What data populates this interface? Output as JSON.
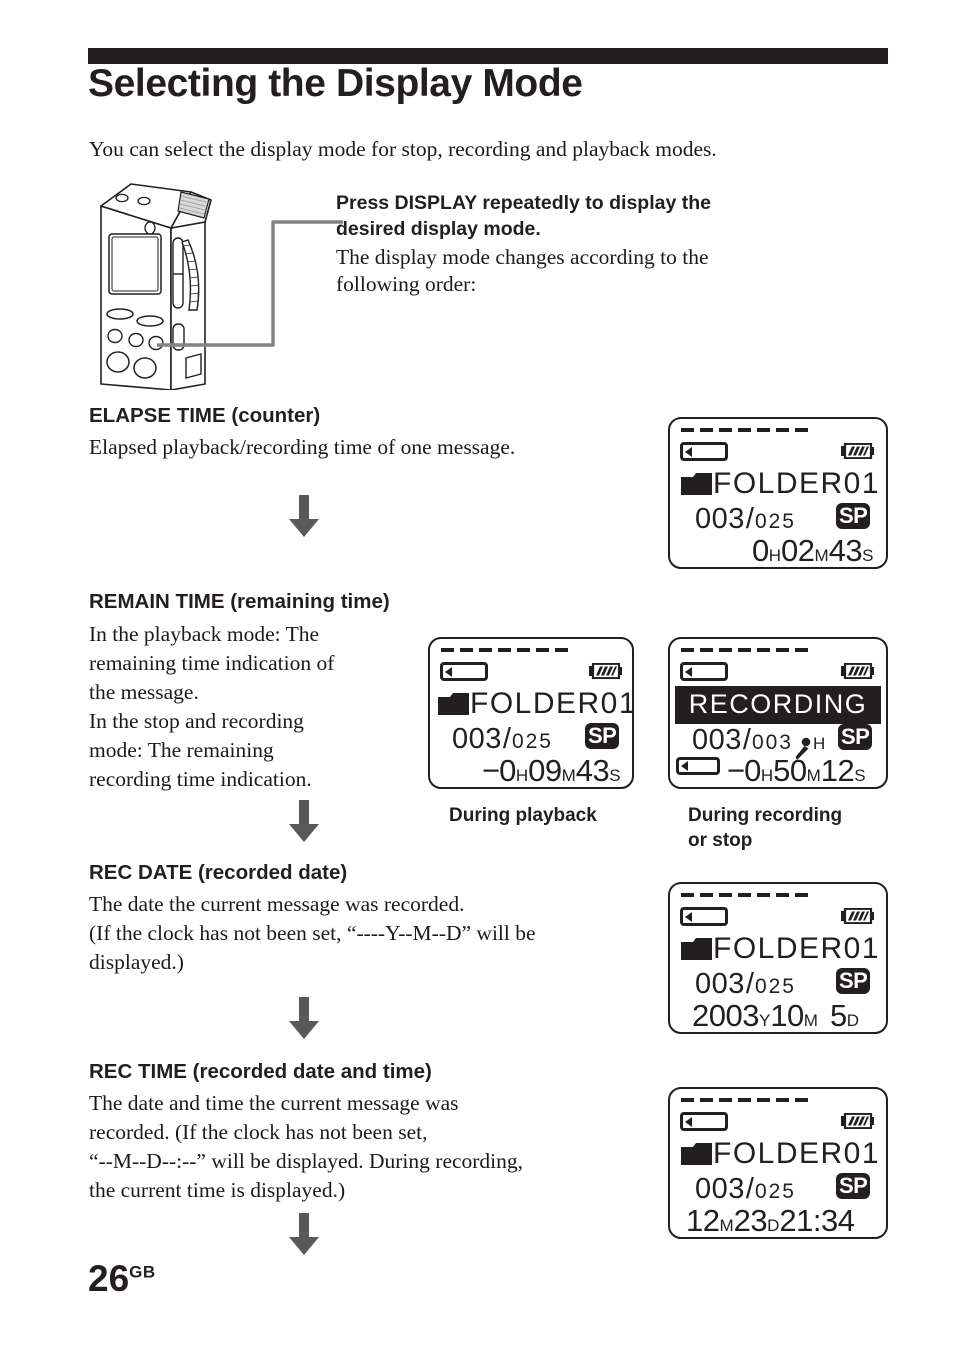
{
  "page": {
    "title": "Selecting the Display Mode",
    "intro": "You can select the display mode for stop, recording and playback modes.",
    "page_number": "26",
    "page_number_suffix": "GB"
  },
  "callout": {
    "bold_line_1": "Press DISPLAY repeatedly to display the",
    "bold_line_2": "desired display mode.",
    "normal_line_1": "The display mode changes according to the",
    "normal_line_2": "following order:"
  },
  "sections": [
    {
      "heading": "ELAPSE TIME (counter)",
      "body": "Elapsed playback/recording time of one message."
    },
    {
      "heading": "REMAIN TIME (remaining time)",
      "body_lines": [
        "In the playback mode: The",
        "remaining time indication of",
        "the message.",
        "In the stop and recording",
        "mode: The remaining",
        "recording time indication."
      ]
    },
    {
      "heading": "REC DATE (recorded date)",
      "body_lines": [
        "The date the current message was recorded.",
        "(If the clock has not been set, “----Y--M--D” will be",
        "displayed.)"
      ]
    },
    {
      "heading": "REC TIME (recorded date and time)",
      "body_lines": [
        "The date and time the current message was",
        "recorded.  (If the clock has not been set,",
        "“--M--D--:--” will be displayed.  During recording,",
        "the current time is displayed.)"
      ]
    }
  ],
  "displays": {
    "elapse": {
      "folder": "FOLDER01",
      "message_current": "003",
      "separator": "/",
      "message_total": "025",
      "mode_badge": "SP",
      "time_h": "0",
      "unit_h": "H",
      "time_m": "02",
      "unit_m": "M",
      "time_s": "43",
      "unit_s": "S"
    },
    "remain_playback": {
      "folder": "FOLDER01",
      "message_current": "003",
      "separator": "/",
      "message_total": "025",
      "mode_badge": "SP",
      "minus": "−",
      "time_h": "0",
      "unit_h": "H",
      "time_m": "09",
      "unit_m": "M",
      "time_s": "43",
      "unit_s": "S",
      "caption": "During playback"
    },
    "remain_recording": {
      "banner": "RECORDING",
      "message_current": "003",
      "separator": "/",
      "message_total": "003",
      "mic_unit": "H",
      "mode_badge": "SP",
      "minus": "−",
      "time_h": "0",
      "unit_h": "H",
      "time_m": "50",
      "unit_m": "M",
      "time_s": "12",
      "unit_s": "S",
      "caption_line_1": "During recording",
      "caption_line_2": "or stop"
    },
    "rec_date": {
      "folder": "FOLDER01",
      "message_current": "003",
      "separator": "/",
      "message_total": "025",
      "mode_badge": "SP",
      "year": "2003",
      "unit_y": "Y",
      "month": "10",
      "unit_mo": "M",
      "day": "5",
      "unit_d": "D"
    },
    "rec_time": {
      "folder": "FOLDER01",
      "message_current": "003",
      "separator": "/",
      "message_total": "025",
      "mode_badge": "SP",
      "month": "12",
      "unit_mo": "M",
      "day": "23",
      "unit_d": "D",
      "clock": "21:34"
    }
  },
  "colors": {
    "ink": "#231f20",
    "arrow": "#58595b"
  }
}
